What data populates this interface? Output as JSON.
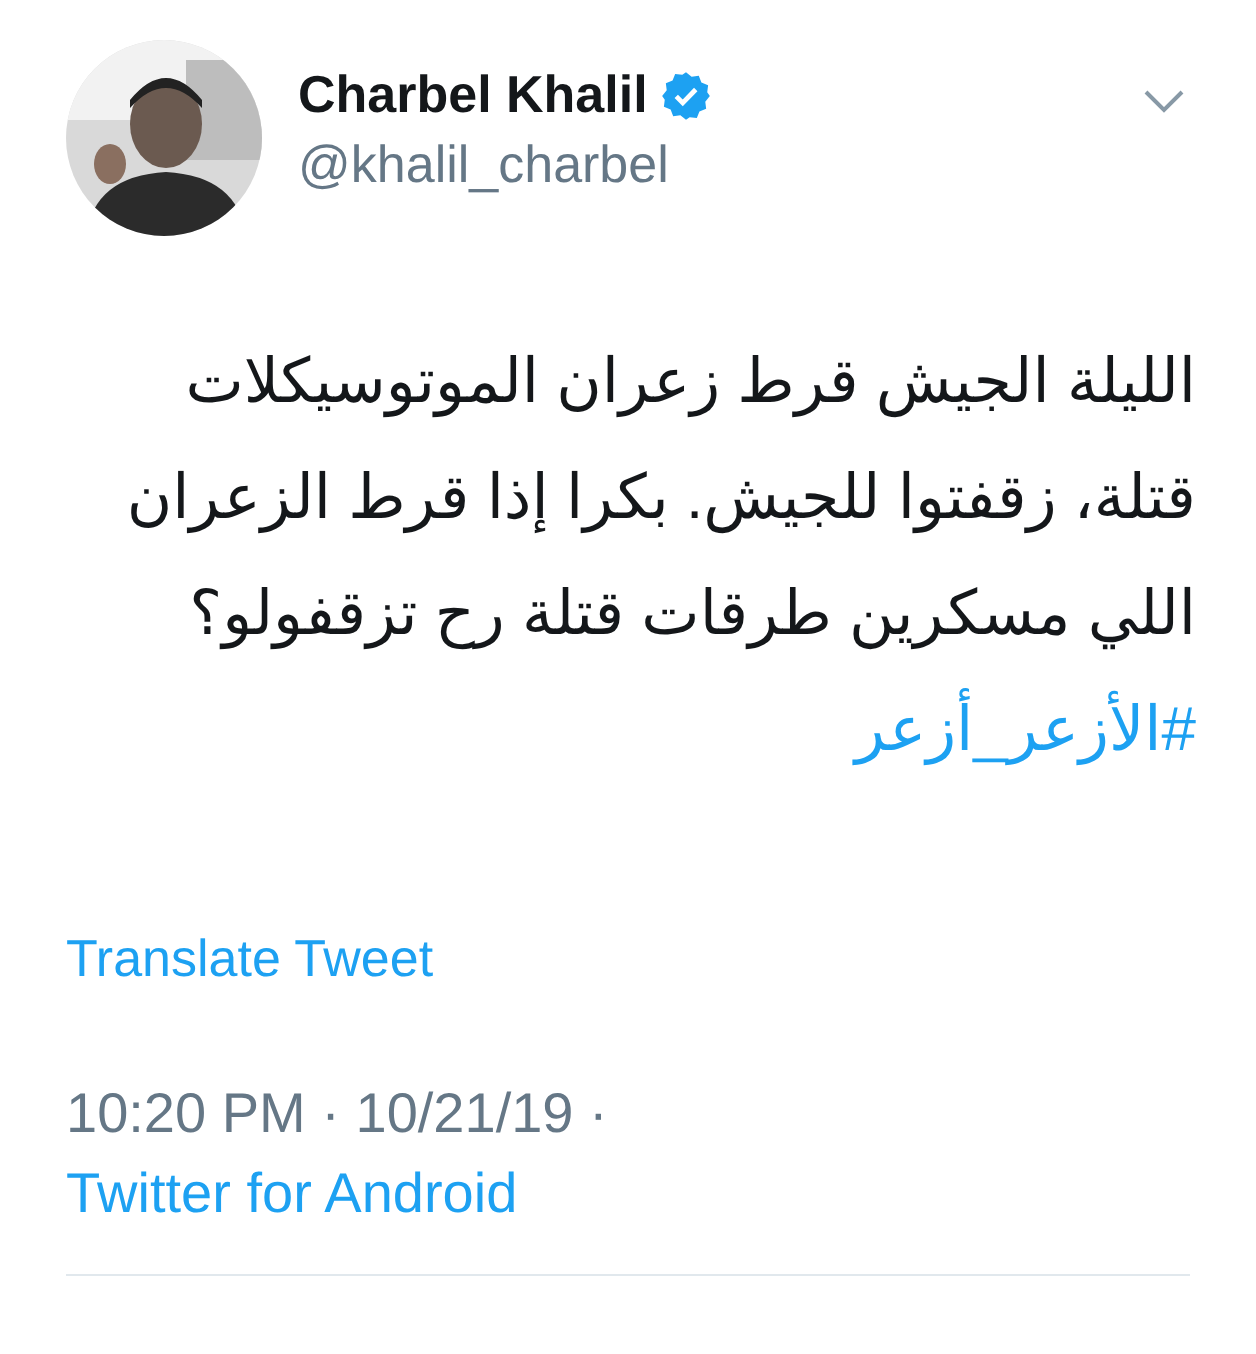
{
  "author": {
    "name": "Charbel Khalil",
    "verified": true,
    "handle": "@khalil_charbel"
  },
  "tweet": {
    "text": "الليلة الجيش قرط زعران الموتوسيكلات قتلة، زقفتوا للجيش. بكرا إذا قرط الزعران اللي مسكرين طرقات قتلة رح تزقفولو؟",
    "hashtag": "#الأزعر_أزعر"
  },
  "translate_link": "Translate Tweet",
  "meta": {
    "time": "10:20 PM",
    "separator_1": "·",
    "date": "10/21/19",
    "separator_2": "·",
    "source": "Twitter for Android"
  }
}
